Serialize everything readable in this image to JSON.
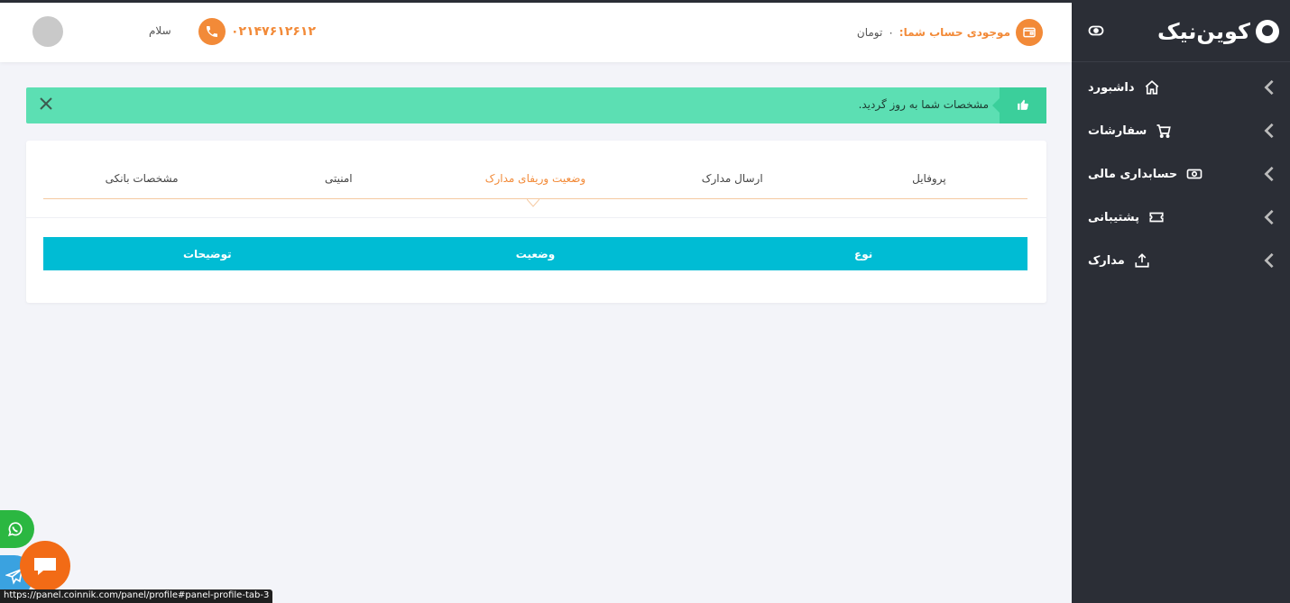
{
  "sidebar": {
    "logo_text": "کوین‌نیک",
    "items": [
      {
        "label": "داشبورد",
        "icon": "home-icon"
      },
      {
        "label": "سفارشات",
        "icon": "cart-icon"
      },
      {
        "label": "حسابداری مالی",
        "icon": "money-icon"
      },
      {
        "label": "پشتیبانی",
        "icon": "ticket-icon"
      },
      {
        "label": "مدارک",
        "icon": "upload-icon"
      }
    ]
  },
  "header": {
    "hello": "سلام",
    "phone": "۰۲۱۴۷۶۱۲۶۱۲",
    "balance_label": "موجودی حساب شما:",
    "balance_amount": "۰",
    "balance_unit": "تومان"
  },
  "alert": {
    "text": "مشخصات شما به روز گردید."
  },
  "tabs": [
    {
      "label": "پروفایل",
      "active": false
    },
    {
      "label": "ارسال مدارک",
      "active": false
    },
    {
      "label": "وضعیت وریفای مدارک",
      "active": true
    },
    {
      "label": "امنیتی",
      "active": false
    },
    {
      "label": "مشخصات بانکی",
      "active": false
    }
  ],
  "table": {
    "columns": [
      "نوع",
      "وضعیت",
      "توضیحات"
    ]
  },
  "status_bar": {
    "url": "https://panel.coinnik.com/panel/profile#panel-profile-tab-3"
  },
  "colors": {
    "accent": "#f28a38",
    "sidebar_bg": "#2b2e36",
    "alert_bg": "#5cdfb3",
    "table_head": "#00bcd4"
  }
}
